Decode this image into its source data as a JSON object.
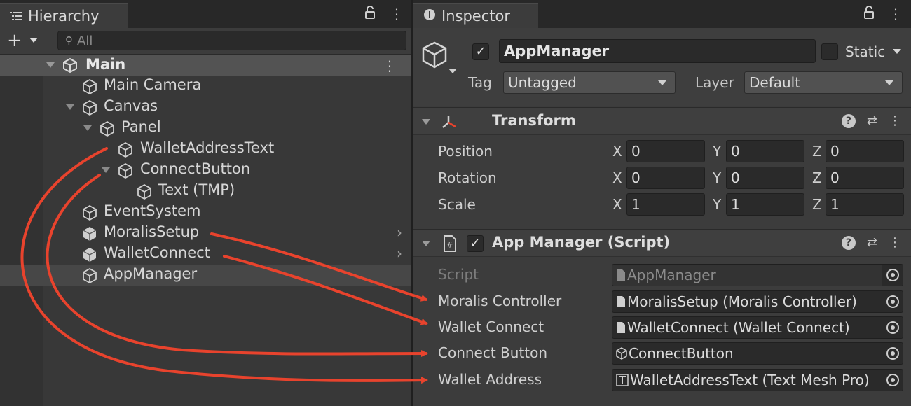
{
  "hierarchy": {
    "tab_label": "Hierarchy",
    "add_button": "+",
    "search_placeholder": "All",
    "scene": {
      "label": "Main"
    },
    "items": [
      {
        "label": "Main Camera"
      },
      {
        "label": "Canvas"
      },
      {
        "label": "Panel"
      },
      {
        "label": "WalletAddressText"
      },
      {
        "label": "ConnectButton"
      },
      {
        "label": "Text (TMP)"
      },
      {
        "label": "EventSystem"
      },
      {
        "label": "MoralisSetup"
      },
      {
        "label": "WalletConnect"
      },
      {
        "label": "AppManager"
      }
    ]
  },
  "inspector": {
    "tab_label": "Inspector",
    "object_name": "AppManager",
    "active": true,
    "static_label": "Static",
    "tag_label": "Tag",
    "tag_value": "Untagged",
    "layer_label": "Layer",
    "layer_value": "Default",
    "transform": {
      "title": "Transform",
      "rows": [
        {
          "label": "Position",
          "x": "0",
          "y": "0",
          "z": "0"
        },
        {
          "label": "Rotation",
          "x": "0",
          "y": "0",
          "z": "0"
        },
        {
          "label": "Scale",
          "x": "1",
          "y": "1",
          "z": "1"
        }
      ],
      "axis_x": "X",
      "axis_y": "Y",
      "axis_z": "Z"
    },
    "script_component": {
      "title": "App Manager (Script)",
      "enabled": true,
      "fields": [
        {
          "label": "Script",
          "value": "AppManager"
        },
        {
          "label": "Moralis Controller",
          "value": "MoralisSetup (Moralis Controller)"
        },
        {
          "label": "Wallet Connect",
          "value": "WalletConnect (Wallet Connect)"
        },
        {
          "label": "Connect Button",
          "value": "ConnectButton"
        },
        {
          "label": "Wallet Address",
          "value": "WalletAddressText (Text Mesh Pro)"
        }
      ]
    }
  },
  "colors": {
    "annotation_arrow": "#e8432d",
    "panel_bg": "#383838",
    "selected_row": "#474747"
  }
}
